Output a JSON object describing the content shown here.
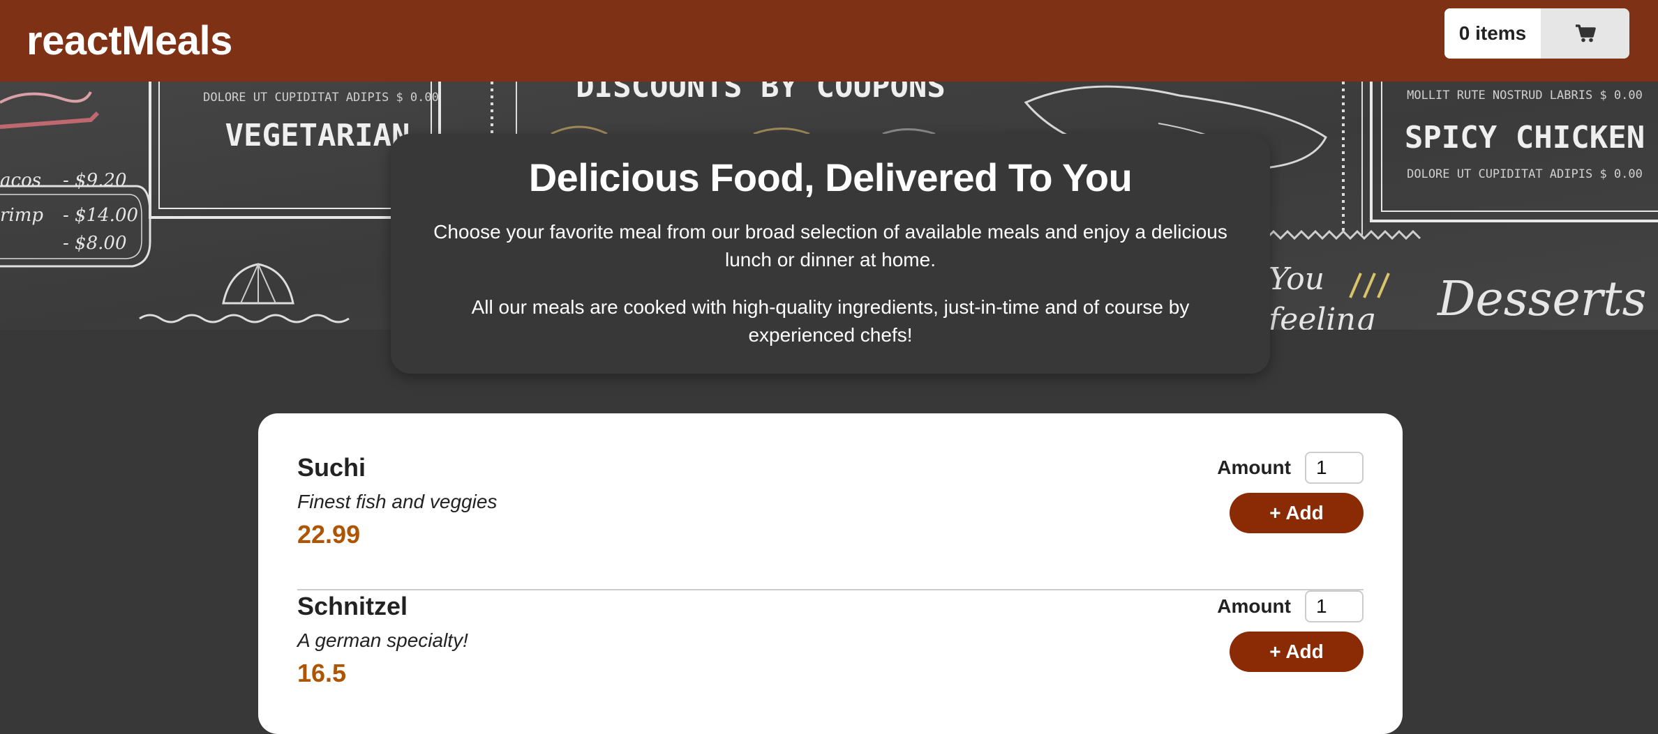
{
  "header": {
    "brand": "reactMeals",
    "cart": {
      "count_label": "0 items",
      "icon": "cart-icon"
    }
  },
  "hero": {
    "chalk_text": {
      "vegetarian": "VEGETARIAN",
      "spicy_chicken": "SPICY CHICKEN",
      "discounts": "DISCOUNTS BY COUPONS",
      "desserts": "Desserts",
      "price_1": "- $9.20",
      "price_2": "- $14.00",
      "price_3": "- $8.00",
      "left_1": "acos",
      "left_2": "rimp",
      "small_1": "DOLORE UT CUPIDITAT ADIPIS $ 0.00",
      "small_2": "MOLLIT RUTE NOSTRUD LABRIS $ 0.00",
      "you": "You",
      "feeling": "feeling"
    }
  },
  "summary": {
    "title": "Delicious Food, Delivered To You",
    "paragraph_1": "Choose your favorite meal from our broad selection of available meals and enjoy a delicious lunch or dinner at home.",
    "paragraph_2": "All our meals are cooked with high-quality ingredients, just-in-time and of course by experienced chefs!"
  },
  "meals": {
    "amount_label": "Amount",
    "add_label": "+ Add",
    "items": [
      {
        "name": "Suchi",
        "description": "Finest fish and veggies",
        "price": "22.99",
        "amount": "1"
      },
      {
        "name": "Schnitzel",
        "description": "A german specialty!",
        "price": "16.5",
        "amount": "1"
      }
    ]
  },
  "colors": {
    "header": "#7f3115",
    "background": "#383838",
    "price": "#ad5502",
    "button": "#8a2b06"
  }
}
